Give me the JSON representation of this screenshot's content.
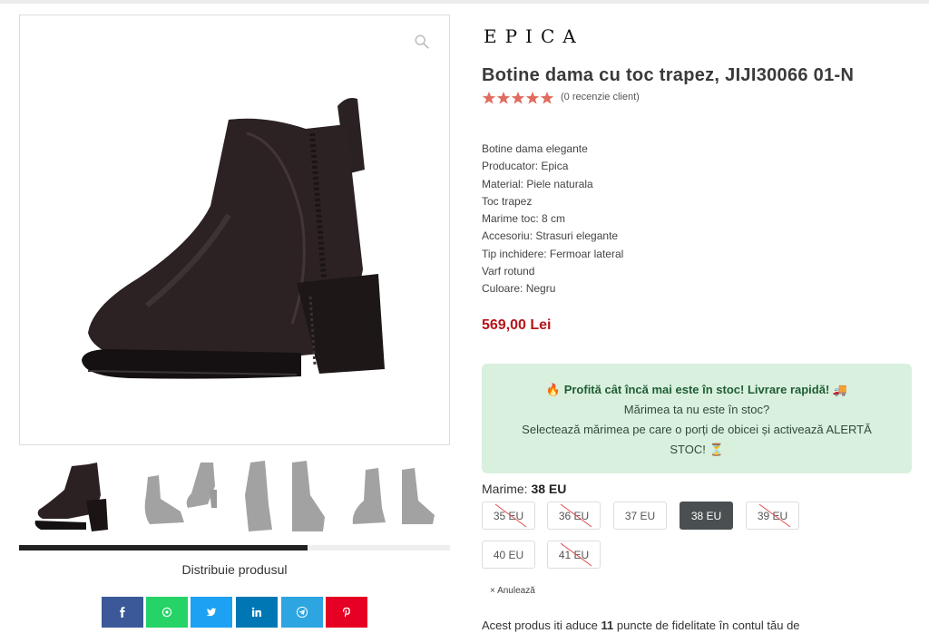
{
  "brand": "EPICA",
  "product": {
    "title": "Botine dama cu toc trapez, JIJI30066 01-N",
    "reviews": "(0 recenzie client)",
    "rating_stars": 5,
    "description": [
      "Botine dama elegante",
      "Producator: Epica",
      "Material: Piele naturala",
      "Toc trapez",
      "Marime toc: 8 cm",
      "Accesoriu: Strasuri elegante",
      "Tip inchidere: Fermoar lateral",
      "Varf rotund",
      "Culoare: Negru"
    ],
    "price": "569,00 Lei"
  },
  "alert": {
    "line1": "Profită cât încă mai este în stoc! Livrare rapidă!",
    "line2": "Mărimea ta nu este în stoc?",
    "line3": "Selectează mărimea pe care o porți de obicei și activează ALERTĂ",
    "line4": "STOC!"
  },
  "sizes": {
    "label": "Marime:",
    "selected": "38 EU",
    "options": [
      {
        "label": "35 EU",
        "available": false
      },
      {
        "label": "36 EU",
        "available": false
      },
      {
        "label": "37 EU",
        "available": true
      },
      {
        "label": "38 EU",
        "available": true
      },
      {
        "label": "39 EU",
        "available": false
      },
      {
        "label": "40 EU",
        "available": true
      },
      {
        "label": "41 EU",
        "available": false
      }
    ],
    "cancel": "Anulează"
  },
  "gallery": {
    "slider_progress": 0.67
  },
  "share": {
    "label": "Distribuie produsul",
    "buttons": [
      {
        "name": "facebook",
        "color": "#3b5998"
      },
      {
        "name": "whatsapp",
        "color": "#25d366"
      },
      {
        "name": "twitter",
        "color": "#1da1f2"
      },
      {
        "name": "linkedin",
        "color": "#0077b5"
      },
      {
        "name": "telegram",
        "color": "#2ca5e0"
      },
      {
        "name": "pinterest",
        "color": "#e60023"
      }
    ]
  },
  "loyalty": {
    "prefix": "Acest produs iti aduce ",
    "points": "11",
    "suffix": " puncte de fidelitate în contul tău de"
  },
  "colors": {
    "price": "#b7141b",
    "alert_bg": "#d9f0df",
    "star": "#e06c5f",
    "selected_size": "#4a4f52"
  }
}
